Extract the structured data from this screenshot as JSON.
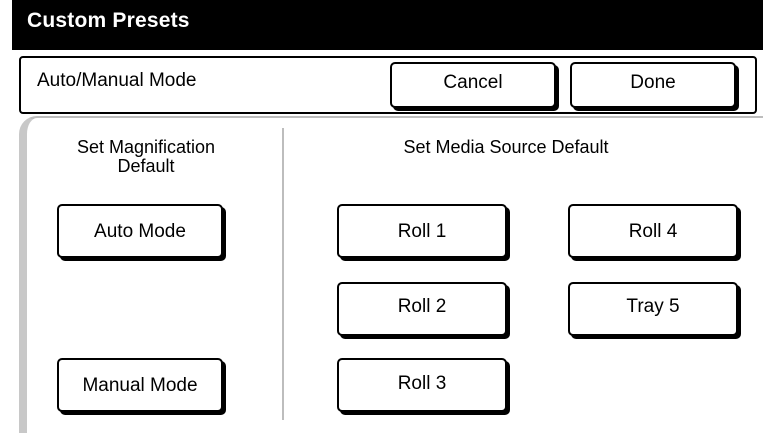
{
  "window": {
    "title": "Custom Presets"
  },
  "header": {
    "mode_label": "Auto/Manual Mode",
    "cancel_label": "Cancel",
    "done_label": "Done"
  },
  "magnification": {
    "title": "Set Magnification Default",
    "auto_label": "Auto Mode",
    "manual_label": "Manual Mode"
  },
  "media_source": {
    "title": "Set Media Source Default",
    "roll1": "Roll 1",
    "roll2": "Roll 2",
    "roll3": "Roll 3",
    "roll4": "Roll 4",
    "tray5": "Tray 5"
  },
  "colors": {
    "title_bar": "#000000",
    "panel_bg": "#ffffff",
    "divider": "#bdbdbd"
  }
}
